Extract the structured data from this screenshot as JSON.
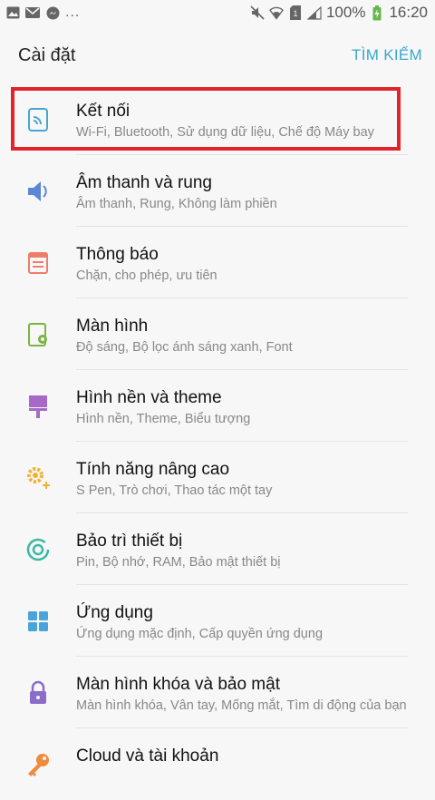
{
  "status_bar": {
    "notif_dots": "...",
    "battery_text": "100%",
    "time": "16:20",
    "icons": [
      "image-icon",
      "mail-icon",
      "messenger-icon",
      "mute-icon",
      "wifi-icon",
      "sim-icon",
      "signal-icon",
      "battery-icon"
    ]
  },
  "header": {
    "title": "Cài đặt",
    "search_label": "TÌM KIẾM",
    "accent_color": "#3aa8c9"
  },
  "settings": {
    "items": [
      {
        "title": "Kết nối",
        "subtitle": "Wi-Fi, Bluetooth, Sử dụng dữ liệu, Chế độ Máy bay",
        "icon": "connection-icon",
        "color": "#48a6cf",
        "highlighted": true
      },
      {
        "title": "Âm thanh và rung",
        "subtitle": "Âm thanh, Rung, Không làm phiền",
        "icon": "volume-icon",
        "color": "#5b87d6"
      },
      {
        "title": "Thông báo",
        "subtitle": "Chặn, cho phép, ưu tiên",
        "icon": "notification-icon",
        "color": "#ef7d6b"
      },
      {
        "title": "Màn hình",
        "subtitle": "Độ sáng, Bộ lọc ánh sáng xanh, Font",
        "icon": "display-icon",
        "color": "#7cb342"
      },
      {
        "title": "Hình nền và theme",
        "subtitle": "Hình nền, Theme, Biểu tượng",
        "icon": "wallpaper-icon",
        "color": "#a56ac7"
      },
      {
        "title": "Tính năng nâng cao",
        "subtitle": "S Pen, Trò chơi, Thao tác một tay",
        "icon": "advanced-icon",
        "color": "#f2b134"
      },
      {
        "title": "Bảo trì thiết bị",
        "subtitle": "Pin, Bộ nhớ, RAM, Bảo mật thiết bị",
        "icon": "maintenance-icon",
        "color": "#3cb8a6"
      },
      {
        "title": "Ứng dụng",
        "subtitle": "Ứng dụng mặc định, Cấp quyền ứng dụng",
        "icon": "apps-icon",
        "color": "#4ba4d9"
      },
      {
        "title": "Màn hình khóa và bảo mật",
        "subtitle": "Màn hình khóa, Vân tay, Mống mắt, Tìm di động của bạn",
        "icon": "lock-icon",
        "color": "#8a6cc9"
      },
      {
        "title": "Cloud và tài khoản",
        "subtitle": "",
        "icon": "key-icon",
        "color": "#f08a3c"
      }
    ]
  }
}
